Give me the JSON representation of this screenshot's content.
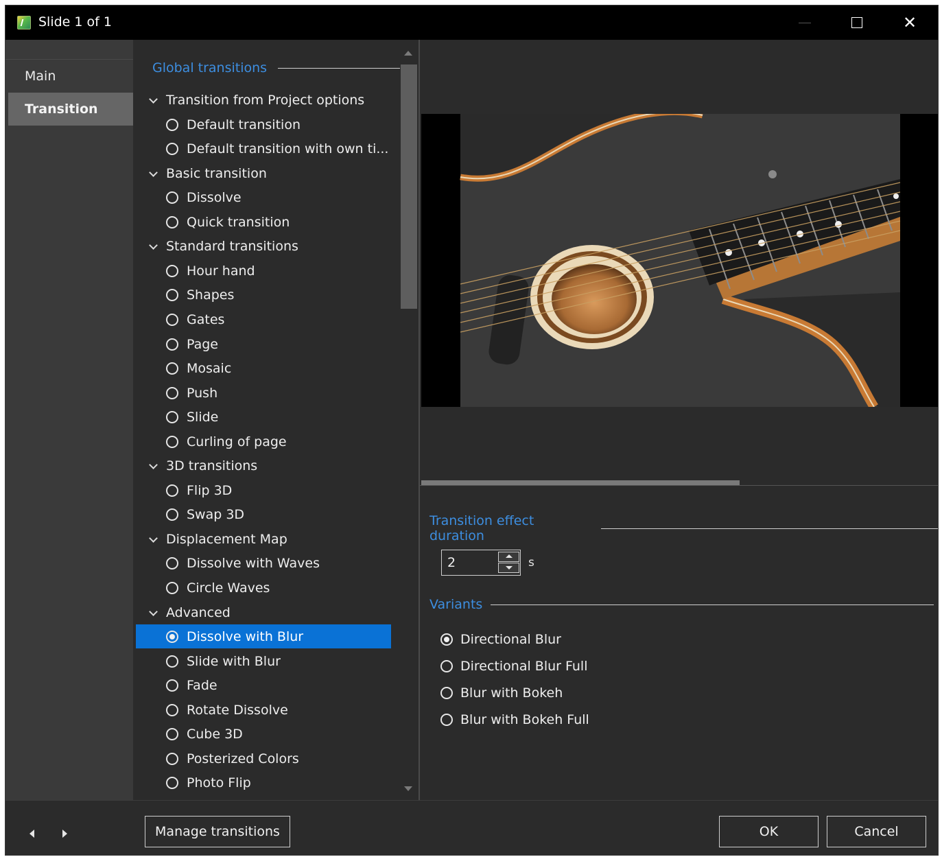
{
  "window": {
    "title": "Slide 1 of 1"
  },
  "sidebar": {
    "items": [
      {
        "label": "Main"
      },
      {
        "label": "Transition"
      }
    ]
  },
  "tree": {
    "section_title": "Global transitions",
    "rows": [
      {
        "kind": "group",
        "label": "Transition from Project options"
      },
      {
        "kind": "item",
        "label": "Default transition"
      },
      {
        "kind": "item",
        "label": "Default transition with own ti..."
      },
      {
        "kind": "group",
        "label": "Basic transition"
      },
      {
        "kind": "item",
        "label": "Dissolve"
      },
      {
        "kind": "item",
        "label": "Quick transition"
      },
      {
        "kind": "group",
        "label": "Standard transitions"
      },
      {
        "kind": "item",
        "label": "Hour hand"
      },
      {
        "kind": "item",
        "label": "Shapes"
      },
      {
        "kind": "item",
        "label": "Gates"
      },
      {
        "kind": "item",
        "label": "Page"
      },
      {
        "kind": "item",
        "label": "Mosaic"
      },
      {
        "kind": "item",
        "label": "Push"
      },
      {
        "kind": "item",
        "label": "Slide"
      },
      {
        "kind": "item",
        "label": "Curling of page"
      },
      {
        "kind": "group",
        "label": "3D transitions"
      },
      {
        "kind": "item",
        "label": "Flip 3D"
      },
      {
        "kind": "item",
        "label": "Swap 3D"
      },
      {
        "kind": "group",
        "label": "Displacement Map"
      },
      {
        "kind": "item",
        "label": "Dissolve with Waves"
      },
      {
        "kind": "item",
        "label": "Circle Waves"
      },
      {
        "kind": "group",
        "label": "Advanced"
      },
      {
        "kind": "item",
        "label": "Dissolve with Blur",
        "selected": true
      },
      {
        "kind": "item",
        "label": "Slide with Blur"
      },
      {
        "kind": "item",
        "label": "Fade"
      },
      {
        "kind": "item",
        "label": "Rotate Dissolve"
      },
      {
        "kind": "item",
        "label": "Cube 3D"
      },
      {
        "kind": "item",
        "label": "Posterized Colors"
      },
      {
        "kind": "item",
        "label": "Photo Flip"
      }
    ]
  },
  "settings": {
    "duration_title": "Transition effect duration",
    "duration_value": "2",
    "duration_unit": "s",
    "variants_title": "Variants",
    "variants": [
      {
        "label": "Directional Blur",
        "selected": true
      },
      {
        "label": "Directional Blur Full",
        "selected": false
      },
      {
        "label": "Blur with Bokeh",
        "selected": false
      },
      {
        "label": "Blur with Bokeh Full",
        "selected": false
      }
    ]
  },
  "footer": {
    "manage_label": "Manage transitions",
    "ok_label": "OK",
    "cancel_label": "Cancel"
  },
  "colors": {
    "accent": "#0a72d6",
    "section_title": "#3d8ee0",
    "background": "#2b2b2b",
    "titlebar": "#000000"
  }
}
